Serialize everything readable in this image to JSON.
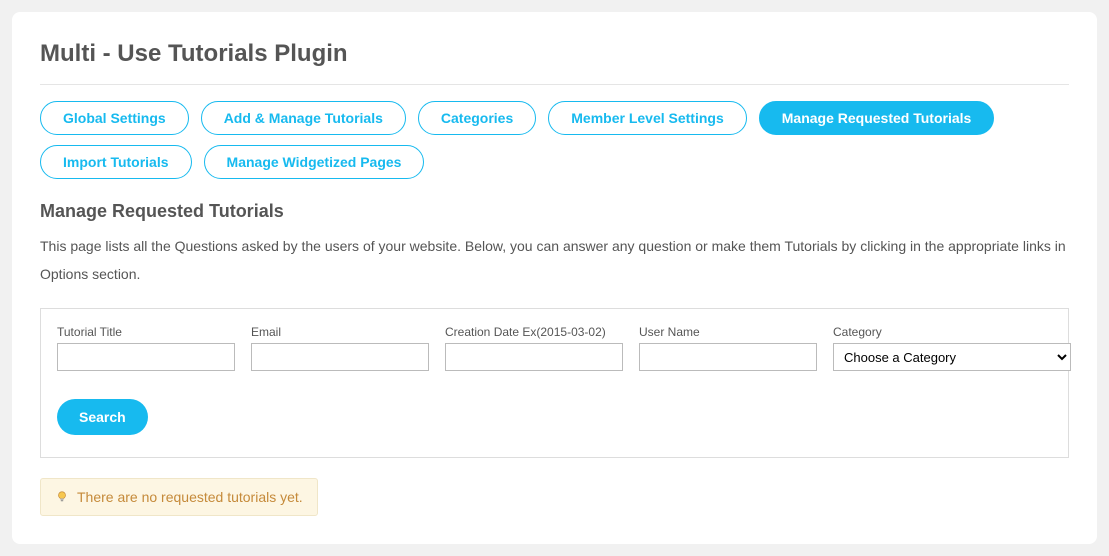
{
  "title": "Multi - Use Tutorials Plugin",
  "tabs": [
    {
      "label": "Global Settings",
      "active": false
    },
    {
      "label": "Add & Manage Tutorials",
      "active": false
    },
    {
      "label": "Categories",
      "active": false
    },
    {
      "label": "Member Level Settings",
      "active": false
    },
    {
      "label": "Manage Requested Tutorials",
      "active": true
    },
    {
      "label": "Import Tutorials",
      "active": false
    },
    {
      "label": "Manage Widgetized Pages",
      "active": false
    }
  ],
  "section": {
    "heading": "Manage Requested Tutorials",
    "description": "This page lists all the Questions asked by the users of your website. Below, you can answer any question or make them Tutorials by clicking in the appropriate links in Options section."
  },
  "filters": {
    "title_label": "Tutorial Title",
    "email_label": "Email",
    "date_label": "Creation Date Ex(2015-03-02)",
    "username_label": "User Name",
    "category_label": "Category",
    "category_selected": "Choose a Category",
    "search_label": "Search"
  },
  "notice": "There are no requested tutorials yet."
}
